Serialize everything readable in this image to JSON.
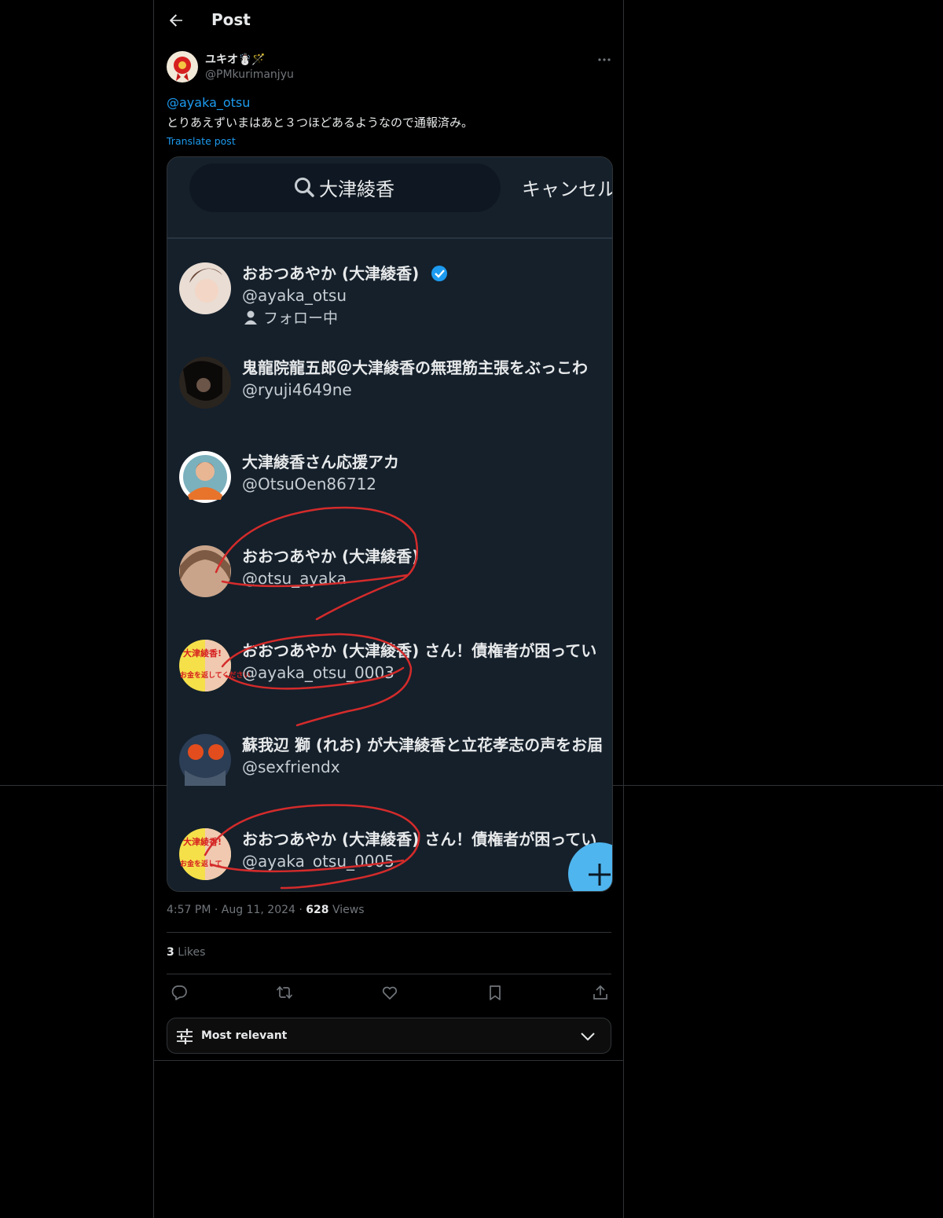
{
  "header": {
    "title": "Post"
  },
  "author": {
    "name": "ユキオ☃️🪄",
    "handle": "@PMkurimanjyu"
  },
  "post": {
    "mention": "@ayaka_otsu",
    "text": "とりあえずいまはあと３つほどあるようなので通報済み。",
    "translate_label": "Translate post"
  },
  "screenshot": {
    "search_query": "大津綾香",
    "cancel_label": "キャンセル",
    "results": [
      {
        "name": "おおつあやか (大津綾香)",
        "handle": "@ayaka_otsu",
        "status": "フォロー中",
        "verified": true
      },
      {
        "name": "鬼龍院龍五郎＠大津綾香の無理筋主張をぶっこわ",
        "handle": "@ryuji4649ne"
      },
      {
        "name": "大津綾香さん応援アカ",
        "handle": "@OtsuOen86712"
      },
      {
        "name": "おおつあやか (大津綾香)",
        "handle": "@otsu_ayaka"
      },
      {
        "name": "おおつあやか (大津綾香) さん！債権者が困ってい",
        "handle": "@ayaka_otsu_0003"
      },
      {
        "name": "蘇我辺 獅 (れお) が大津綾香と立花孝志の声をお届",
        "handle": "@sexfriendx"
      },
      {
        "name": "おおつあやか (大津綾香) さん！債権者が困ってい",
        "handle": "@ayaka_otsu_0005"
      }
    ],
    "poster_text_top": "大津綾香!",
    "poster_text_bottom": "お金を返してください",
    "poster_text_bottom2": "お金を返して"
  },
  "meta": {
    "time": "4:57 PM",
    "dot": "·",
    "date": "Aug 11, 2024",
    "views_count": "628",
    "views_label": "Views"
  },
  "likes": {
    "count": "3",
    "label": "Likes"
  },
  "sort": {
    "label": "Most relevant"
  },
  "colors": {
    "accent": "#1d9bf0",
    "background": "#000000",
    "media_background": "#15202b",
    "annotation": "#d42b2b"
  },
  "icons": [
    "back-arrow-icon",
    "more-icon",
    "search-icon",
    "verified-badge-icon",
    "person-icon",
    "fab-plus-icon",
    "reply-icon",
    "repost-icon",
    "like-icon",
    "bookmark-icon",
    "share-icon",
    "sliders-icon",
    "chevron-down-icon"
  ]
}
